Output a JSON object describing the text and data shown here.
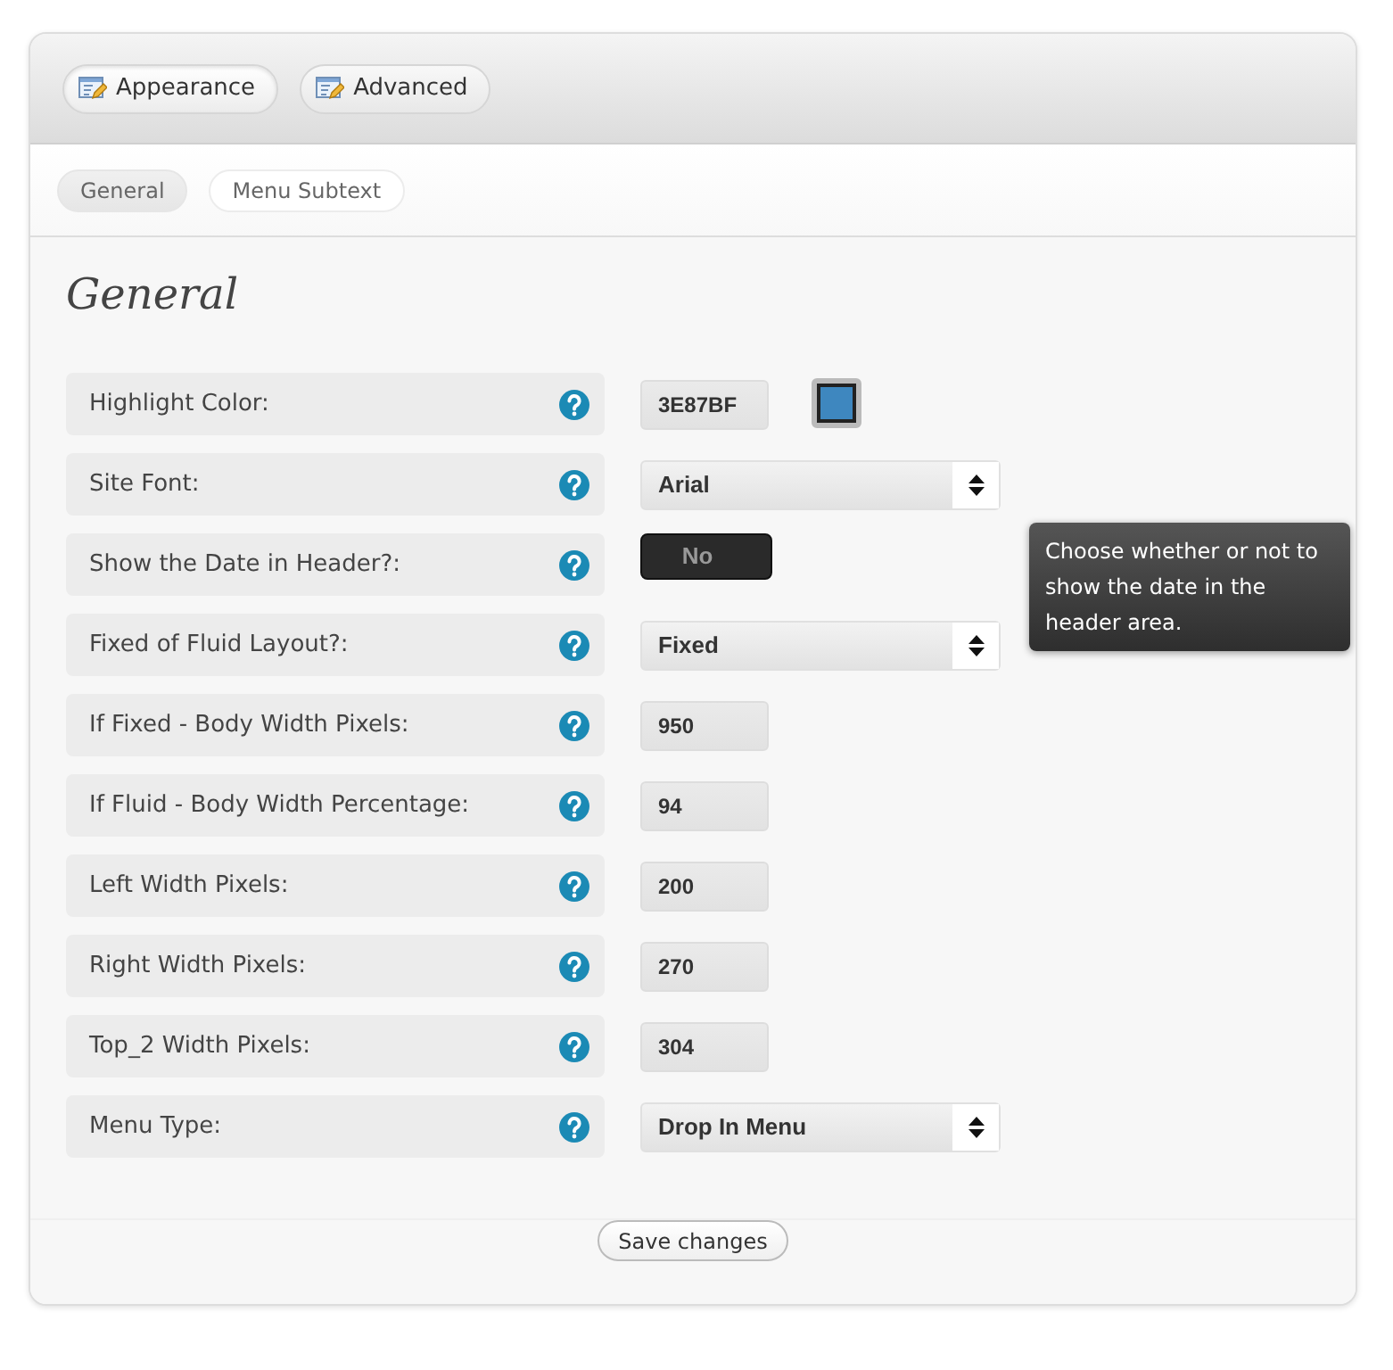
{
  "top_tabs": [
    {
      "label": "Appearance",
      "selected": true
    },
    {
      "label": "Advanced",
      "selected": false
    }
  ],
  "sub_tabs": [
    {
      "label": "General",
      "selected": true
    },
    {
      "label": "Menu Subtext",
      "selected": false
    }
  ],
  "section_title": "General",
  "rows": [
    {
      "kind": "color",
      "label": "Highlight Color:",
      "value": "3E87BF",
      "color": "#3e87bf"
    },
    {
      "kind": "select",
      "label": "Site Font:",
      "value": "Arial"
    },
    {
      "kind": "toggle",
      "label": "Show the Date in Header?:",
      "value": "No",
      "on": false,
      "tooltip": "Choose whether or not to show the date in the header area."
    },
    {
      "kind": "select",
      "label": "Fixed of Fluid Layout?:",
      "value": "Fixed"
    },
    {
      "kind": "text",
      "label": "If Fixed - Body Width Pixels:",
      "value": "950"
    },
    {
      "kind": "text",
      "label": "If Fluid - Body Width Percentage:",
      "value": "94"
    },
    {
      "kind": "text",
      "label": "Left Width Pixels:",
      "value": "200"
    },
    {
      "kind": "text",
      "label": "Right Width Pixels:",
      "value": "270"
    },
    {
      "kind": "text",
      "label": "Top_2 Width Pixels:",
      "value": "304"
    },
    {
      "kind": "select",
      "label": "Menu Type:",
      "value": "Drop In Menu"
    }
  ],
  "save_button": "Save changes"
}
